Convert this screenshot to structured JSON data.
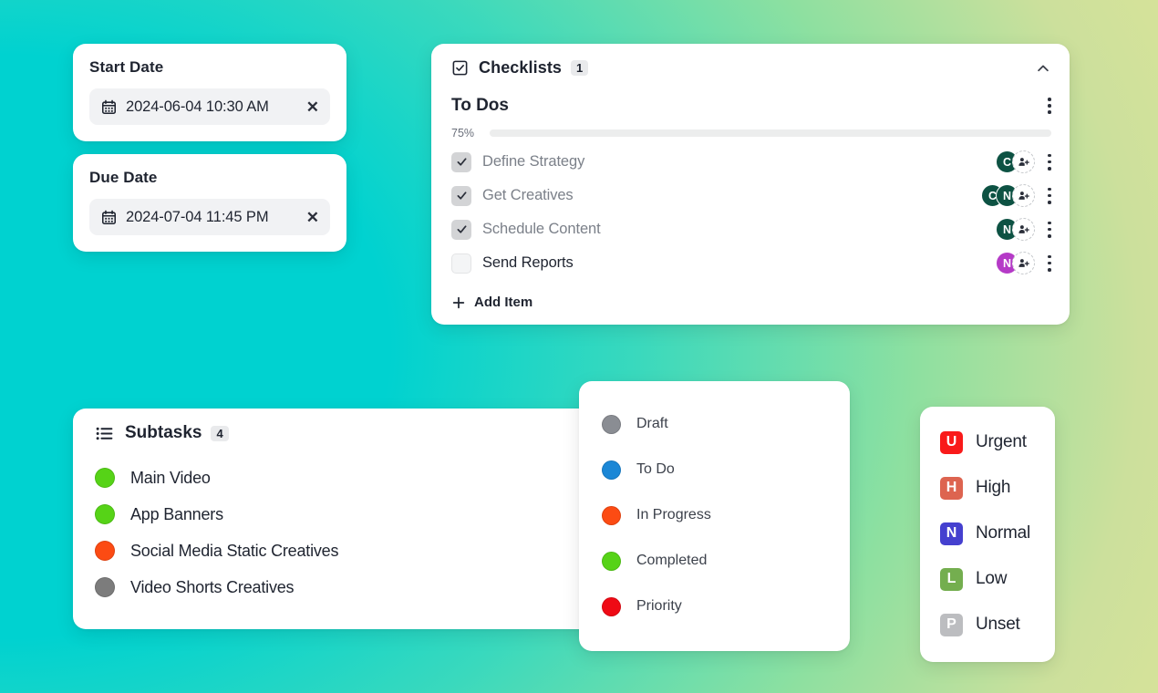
{
  "theme": {
    "bg_gradient_from": "#00d2d0",
    "bg_gradient_mid": "#6fdcb0",
    "bg_gradient_to": "#e2e597",
    "card_bg": "#ffffff",
    "text_primary": "#1f2430",
    "text_muted": "#7b8089"
  },
  "start_date": {
    "label": "Start Date",
    "value": "2024-06-04 10:30 AM",
    "calendar_icon": "calendar-icon",
    "clear_icon": "close-icon",
    "clear_glyph": "✕"
  },
  "due_date": {
    "label": "Due Date",
    "value": "2024-07-04 11:45 PM",
    "calendar_icon": "calendar-icon",
    "clear_icon": "close-icon",
    "clear_glyph": "✕"
  },
  "checklists": {
    "header_icon": "checkbox-icon",
    "title": "Checklists",
    "count": "1",
    "collapse_icon": "chevron-up-icon",
    "menu_icon": "kebab-menu-icon",
    "group": {
      "title": "To Dos",
      "progress_label": "75%",
      "progress_value": 75
    },
    "items": [
      {
        "label": "Define Strategy",
        "checked": true,
        "assignees": [
          {
            "initial": "C",
            "color": "#0d5243"
          }
        ],
        "add_person_icon": "add-person-icon"
      },
      {
        "label": "Get Creatives",
        "checked": true,
        "assignees": [
          {
            "initial": "C",
            "color": "#0d5243"
          },
          {
            "initial": "N",
            "color": "#0d5243"
          }
        ],
        "add_person_icon": "add-person-icon"
      },
      {
        "label": "Schedule Content",
        "checked": true,
        "assignees": [
          {
            "initial": "N",
            "color": "#0d5243"
          }
        ],
        "add_person_icon": "add-person-icon"
      },
      {
        "label": "Send Reports",
        "checked": false,
        "assignees": [
          {
            "initial": "N",
            "color": "#b53ac7"
          }
        ],
        "add_person_icon": "add-person-icon"
      }
    ],
    "add_item": {
      "label": "Add Item",
      "icon": "plus-icon"
    }
  },
  "subtasks": {
    "header_icon": "list-icon",
    "title": "Subtasks",
    "count": "4",
    "items": [
      {
        "label": "Main Video",
        "color": "#56d317"
      },
      {
        "label": "App Banners",
        "color": "#56d317"
      },
      {
        "label": "Social Media Static Creatives",
        "color": "#fc4b13"
      },
      {
        "label": "Video Shorts Creatives",
        "color": "#7c7c7c"
      }
    ]
  },
  "status_menu": {
    "options": [
      {
        "label": "Draft",
        "color": "#8a8d93"
      },
      {
        "label": "To Do",
        "color": "#1b87d6"
      },
      {
        "label": "In Progress",
        "color": "#fc4b13"
      },
      {
        "label": "Completed",
        "color": "#56d317"
      },
      {
        "label": "Priority",
        "color": "#ef0a15"
      }
    ]
  },
  "priority_menu": {
    "options": [
      {
        "label": "Urgent",
        "initial": "U",
        "color": "#f91a1a"
      },
      {
        "label": "High",
        "initial": "H",
        "color": "#dd6450"
      },
      {
        "label": "Normal",
        "initial": "N",
        "color": "#4540cf"
      },
      {
        "label": "Low",
        "initial": "L",
        "color": "#74ae4f"
      },
      {
        "label": "Unset",
        "initial": "P",
        "color": "#bcbdc0"
      }
    ]
  }
}
